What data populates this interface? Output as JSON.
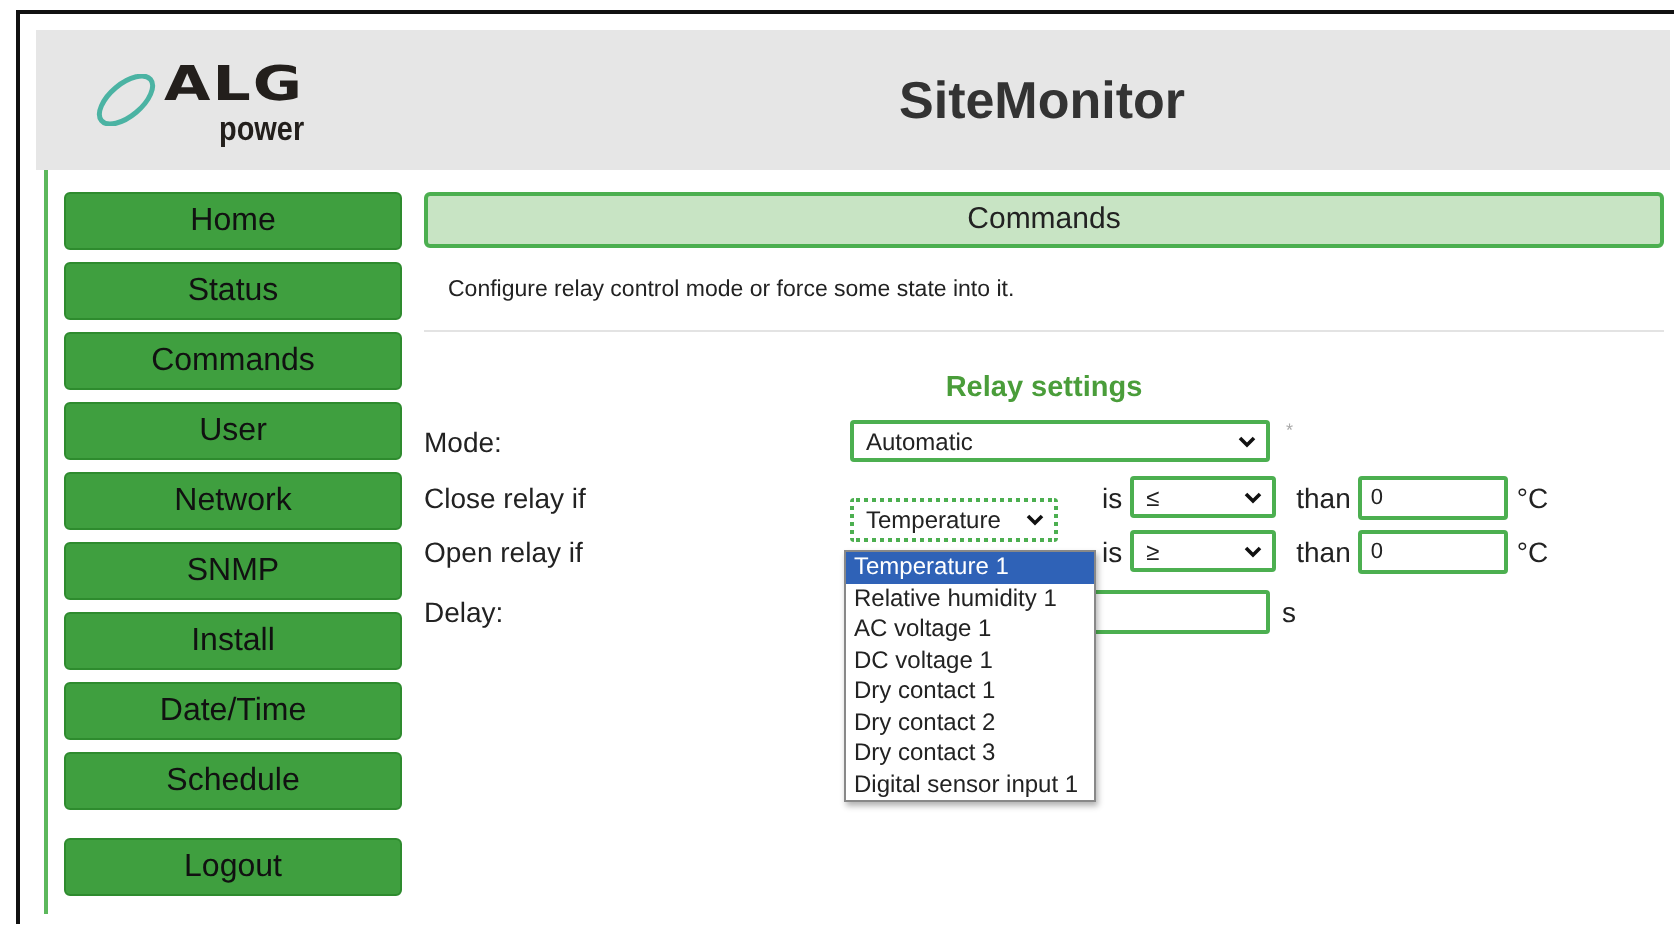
{
  "header": {
    "logo": {
      "name": "ALG",
      "tagline": "power"
    },
    "title": "SiteMonitor"
  },
  "nav": [
    {
      "label": "Home",
      "kind": "page"
    },
    {
      "label": "Status",
      "kind": "page"
    },
    {
      "label": "Commands",
      "kind": "page"
    },
    {
      "label": "User",
      "kind": "page"
    },
    {
      "label": "Network",
      "kind": "page"
    },
    {
      "label": "SNMP",
      "kind": "page"
    },
    {
      "label": "Install",
      "kind": "page"
    },
    {
      "label": "Date/Time",
      "kind": "page"
    },
    {
      "label": "Schedule",
      "kind": "page"
    },
    {
      "label": "Logout",
      "kind": "logout"
    }
  ],
  "panel": {
    "title": "Commands",
    "description": "Configure relay control mode or force some state into it.",
    "section_title": "Relay settings",
    "mode": {
      "label": "Mode:",
      "value": "Automatic",
      "note": "*"
    },
    "close_rule": {
      "label": "Close relay if",
      "sensor": "Temperature",
      "is": "is",
      "operator": "≤",
      "than": "than",
      "threshold": "0",
      "unit": "°C"
    },
    "open_rule": {
      "label": "Open relay if",
      "is": "is",
      "operator": "≥",
      "than": "than",
      "threshold": "0",
      "unit": "°C"
    },
    "delay": {
      "label": "Delay:",
      "unit": "s"
    },
    "sensor_menu": {
      "options": [
        {
          "label": "Temperature 1",
          "selected": true
        },
        {
          "label": "Relative humidity 1",
          "selected": false
        },
        {
          "label": "AC voltage 1",
          "selected": false
        },
        {
          "label": "DC voltage 1",
          "selected": false
        },
        {
          "label": "Dry contact 1",
          "selected": false
        },
        {
          "label": "Dry contact 2",
          "selected": false
        },
        {
          "label": "Dry contact 3",
          "selected": false
        },
        {
          "label": "Digital sensor input 1",
          "selected": false
        }
      ]
    }
  }
}
